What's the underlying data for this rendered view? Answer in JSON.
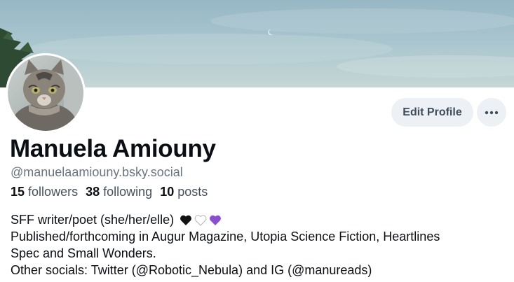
{
  "profile": {
    "display_name": "Manuela Amiouny",
    "handle": "@manuelaamiouny.bsky.social",
    "stats": {
      "followers_count": "15",
      "followers_label": "followers",
      "following_count": "38",
      "following_label": "following",
      "posts_count": "10",
      "posts_label": "posts"
    },
    "bio": {
      "line1": "SFF writer/poet (she/her/elle)",
      "line1_emoji": [
        "black-heart-icon",
        "white-heart-icon",
        "purple-heart-icon"
      ],
      "line2": "Published/forthcoming in Augur Magazine, Utopia Science Fiction, Heartlines",
      "line3": "Spec and Small Wonders.",
      "line4": "Other socials: Twitter (@Robotic_Nebula) and IG (@manureads)"
    }
  },
  "actions": {
    "edit_profile_label": "Edit Profile",
    "more_icon": "ellipsis-icon"
  },
  "colors": {
    "button_bg": "#edf1f5",
    "button_text": "#3e4c5c",
    "handle_text": "#6b7480",
    "primary_text": "#0b0f14"
  }
}
